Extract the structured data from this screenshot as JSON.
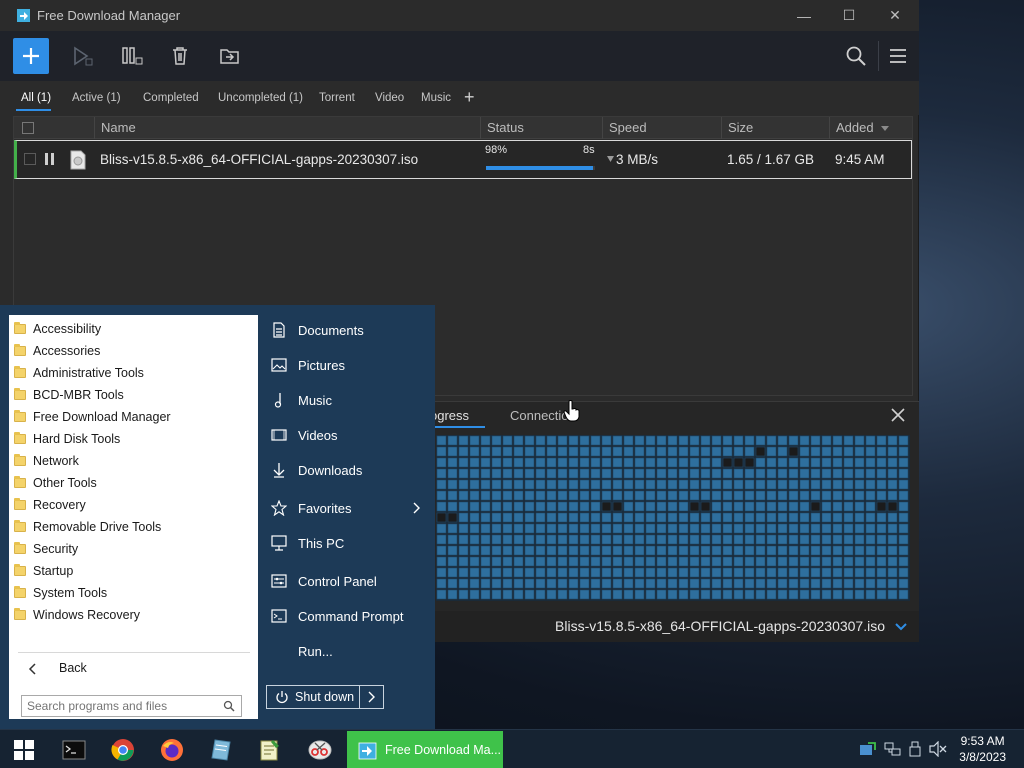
{
  "window": {
    "title": "Free Download Manager",
    "minimize_glyph": "—",
    "maximize_glyph": "☐",
    "close_glyph": "✕"
  },
  "toolbar": {
    "icons": [
      "plus-icon",
      "resume-icon",
      "pause-all-icon",
      "trash-icon",
      "move-icon",
      "search-icon",
      "menu-icon"
    ]
  },
  "tabs": [
    {
      "label": "All (1)",
      "active": true
    },
    {
      "label": "Active (1)"
    },
    {
      "label": "Completed"
    },
    {
      "label": "Uncompleted (1)"
    },
    {
      "label": "Torrent"
    },
    {
      "label": "Video"
    },
    {
      "label": "Music"
    },
    {
      "label": "+"
    }
  ],
  "table": {
    "columns": [
      "Name",
      "Status",
      "Speed",
      "Size",
      "Added"
    ],
    "rows": [
      {
        "name": "Bliss-v15.8.5-x86_64-OFFICIAL-gapps-20230307.iso",
        "percent": "98%",
        "progress": 0.98,
        "eta": "8s",
        "speed": "3 MB/s",
        "size": "1.65 / 1.67 GB",
        "added": "9:45 AM"
      }
    ]
  },
  "bottom_panel": {
    "tabs": [
      "Progress",
      "Connections"
    ],
    "visible_tabs": [
      "ogress",
      "Connectio"
    ],
    "file_name": "Bliss-v15.8.5-x86_64-OFFICIAL-gapps-20230307.iso"
  },
  "start_menu": {
    "programs": [
      "Accessibility",
      "Accessories",
      "Administrative Tools",
      "BCD-MBR Tools",
      "Free Download Manager",
      "Hard Disk Tools",
      "Network",
      "Other Tools",
      "Recovery",
      "Removable Drive Tools",
      "Security",
      "Startup",
      "System Tools",
      "Windows Recovery"
    ],
    "back_label": "Back",
    "search_placeholder": "Search programs and files",
    "places": [
      {
        "label": "Documents",
        "icon": "document-icon"
      },
      {
        "label": "Pictures",
        "icon": "pictures-icon"
      },
      {
        "label": "Music",
        "icon": "music-icon"
      },
      {
        "label": "Videos",
        "icon": "videos-icon"
      },
      {
        "label": "Downloads",
        "icon": "download-icon"
      },
      {
        "label": "Favorites",
        "icon": "star-icon"
      },
      {
        "label": "This PC",
        "icon": "computer-icon"
      },
      {
        "label": "Control Panel",
        "icon": "control-panel-icon"
      },
      {
        "label": "Command Prompt",
        "icon": "cmd-icon"
      },
      {
        "label": "Run...",
        "icon": "run-icon"
      }
    ],
    "shutdown_label": "Shut down"
  },
  "taskbar": {
    "active_task": "Free Download Ma...",
    "time": "9:53 AM",
    "date": "3/8/2023"
  },
  "colors": {
    "accent": "#2f8ee6",
    "task_active": "#3fc24a",
    "start_menu_bg": "#1d3a57",
    "row_active_marker": "#43b04a"
  }
}
